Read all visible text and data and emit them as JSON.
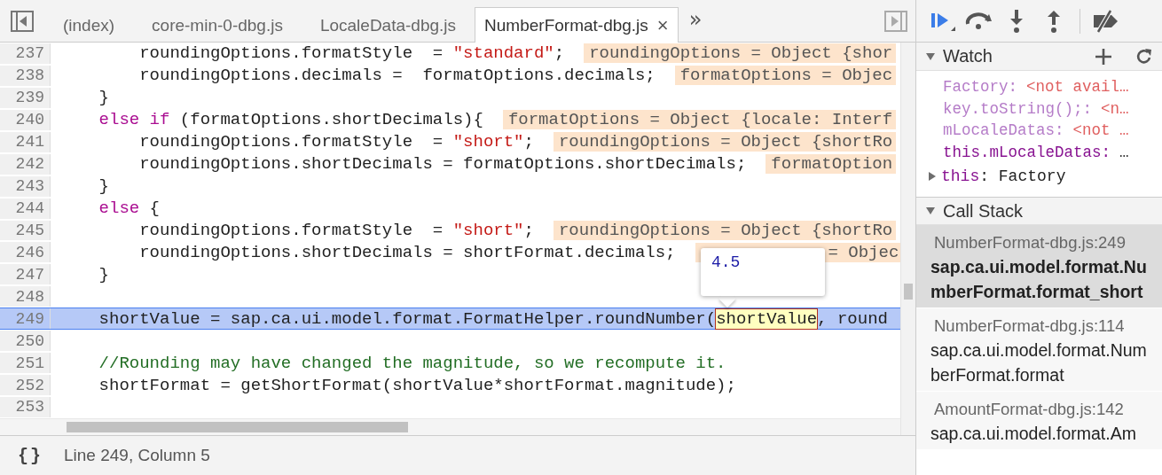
{
  "editor": {
    "tabs": [
      {
        "label": "(index)",
        "selected": false
      },
      {
        "label": "core-min-0-dbg.js",
        "selected": false
      },
      {
        "label": "LocaleData-dbg.js",
        "selected": false
      },
      {
        "label": "NumberFormat-dbg.js",
        "selected": true,
        "close": "×"
      }
    ],
    "more_tabs": "»",
    "lines": [
      {
        "number": "237",
        "current": false,
        "tokens": [
          {
            "kind": "code",
            "text": "        roundingOptions.formatStyle  = "
          },
          {
            "kind": "string",
            "text": "\"standard\""
          },
          {
            "kind": "code",
            "text": ";"
          },
          {
            "kind": "value",
            "text": "roundingOptions = Object {shor"
          }
        ]
      },
      {
        "number": "238",
        "current": false,
        "tokens": [
          {
            "kind": "code",
            "text": "        roundingOptions.decimals =  formatOptions.decimals;"
          },
          {
            "kind": "value",
            "text": "formatOptions = Objec"
          }
        ]
      },
      {
        "number": "239",
        "current": false,
        "tokens": [
          {
            "kind": "code",
            "text": "    }"
          }
        ]
      },
      {
        "number": "240",
        "current": false,
        "tokens": [
          {
            "kind": "keyword",
            "text": "    else if"
          },
          {
            "kind": "code",
            "text": " (formatOptions.shortDecimals){"
          },
          {
            "kind": "value",
            "text": "formatOptions = Object {locale: Interf"
          }
        ]
      },
      {
        "number": "241",
        "current": false,
        "tokens": [
          {
            "kind": "code",
            "text": "        roundingOptions.formatStyle  = "
          },
          {
            "kind": "string",
            "text": "\"short\""
          },
          {
            "kind": "code",
            "text": ";"
          },
          {
            "kind": "value",
            "text": "roundingOptions = Object {shortRo"
          }
        ]
      },
      {
        "number": "242",
        "current": false,
        "tokens": [
          {
            "kind": "code",
            "text": "        roundingOptions.shortDecimals = formatOptions.shortDecimals;"
          },
          {
            "kind": "value",
            "text": "formatOption"
          }
        ]
      },
      {
        "number": "243",
        "current": false,
        "tokens": [
          {
            "kind": "code",
            "text": "    }"
          }
        ]
      },
      {
        "number": "244",
        "current": false,
        "tokens": [
          {
            "kind": "keyword",
            "text": "    else"
          },
          {
            "kind": "code",
            "text": " {"
          }
        ]
      },
      {
        "number": "245",
        "current": false,
        "tokens": [
          {
            "kind": "code",
            "text": "        roundingOptions.formatStyle  = "
          },
          {
            "kind": "string",
            "text": "\"short\""
          },
          {
            "kind": "code",
            "text": ";"
          },
          {
            "kind": "value",
            "text": "roundingOptions = Object {shortRo"
          }
        ]
      },
      {
        "number": "246",
        "current": false,
        "tokens": [
          {
            "kind": "code",
            "text": "        roundingOptions.shortDecimals = shortFormat.decimals;"
          },
          {
            "kind": "covered_value",
            "text": "= Objec"
          }
        ]
      },
      {
        "number": "247",
        "current": false,
        "tokens": [
          {
            "kind": "code",
            "text": "    }"
          }
        ]
      },
      {
        "number": "248",
        "current": false
      },
      {
        "number": "249",
        "current": true,
        "tokens": [
          {
            "kind": "code",
            "text": "    shortValue = sap.ca.ui.model.format.FormatHelper.roundNumber("
          },
          {
            "kind": "hover",
            "text": "shortValue"
          },
          {
            "kind": "code",
            "text": ", round"
          }
        ]
      },
      {
        "number": "250",
        "current": false
      },
      {
        "number": "251",
        "current": false,
        "tokens": [
          {
            "kind": "comment",
            "text": "    //Rounding may have changed the magnitude, so we recompute it."
          }
        ]
      },
      {
        "number": "252",
        "current": false,
        "tokens": [
          {
            "kind": "code",
            "text": "    shortFormat = getShortFormat(shortValue*shortFormat.magnitude);"
          }
        ]
      },
      {
        "number": "253",
        "current": false
      }
    ],
    "tooltip": {
      "value": "4.5"
    },
    "status_bar": {
      "pretty_print": "{}",
      "position": "Line 249, Column 5"
    }
  },
  "debugger": {
    "watch": {
      "title": "Watch",
      "items": [
        {
          "kind": "unavailable",
          "name": "Factory:",
          "value": "<not avail…"
        },
        {
          "kind": "unavailable",
          "name": "key.toString();:",
          "value": "<n…"
        },
        {
          "kind": "unavailable",
          "name": "mLocaleDatas:",
          "value": "<not …"
        },
        {
          "kind": "value",
          "name": "this.mLocaleDatas:",
          "value": "…"
        }
      ],
      "scope": {
        "name": "this",
        "value": ": Factory",
        "expanded": false
      }
    },
    "call_stack": {
      "title": "Call Stack",
      "frames": [
        {
          "location": "NumberFormat-dbg.js:249",
          "function": "sap.ca.ui.model.format.NumberFormat.format_short",
          "selected": true
        },
        {
          "location": "NumberFormat-dbg.js:114",
          "function": "sap.ca.ui.model.format.NumberFormat.format",
          "selected": false
        },
        {
          "location": "AmountFormat-dbg.js:142",
          "function": "sap.ca.ui.model.format.Am",
          "selected": false
        }
      ]
    }
  }
}
